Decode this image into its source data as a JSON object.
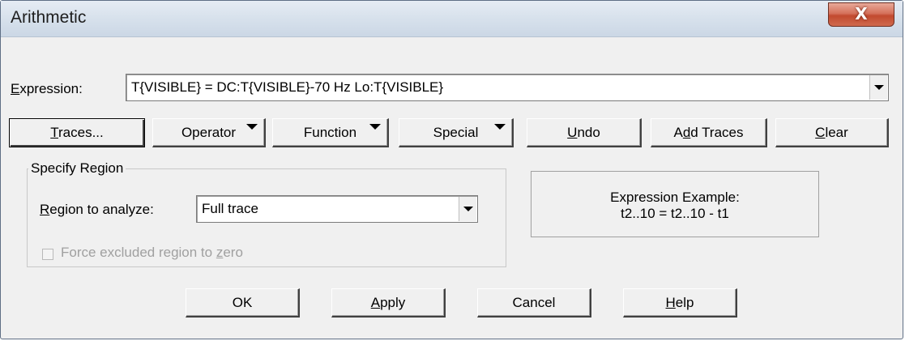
{
  "window": {
    "title": "Arithmetic",
    "close_label": "X"
  },
  "expression": {
    "label_u": "E",
    "label_rest": "xpression:",
    "value": "T{VISIBLE} = DC:T{VISIBLE}-70 Hz Lo:T{VISIBLE}"
  },
  "toolbar": {
    "traces": {
      "u": "T",
      "rest": "races..."
    },
    "operator": "Operator",
    "function": "Function",
    "special": "Special",
    "undo": {
      "u": "U",
      "rest": "ndo"
    },
    "add_traces": {
      "pre": "A",
      "u": "d",
      "rest": "d Traces"
    },
    "clear": {
      "u": "C",
      "rest": "lear"
    }
  },
  "region": {
    "group_title": "Specify Region",
    "label_u": "R",
    "label_rest": "egion to analyze:",
    "value": "Full trace",
    "force_pre": "Force excluded region to ",
    "force_u": "z",
    "force_rest": "ero"
  },
  "example": {
    "line1": "Expression Example:",
    "line2": "t2..10 = t2..10 - t1"
  },
  "footer": {
    "ok": "OK",
    "apply": {
      "u": "A",
      "rest": "pply"
    },
    "cancel": "Cancel",
    "help": {
      "u": "H",
      "rest": "elp"
    }
  }
}
